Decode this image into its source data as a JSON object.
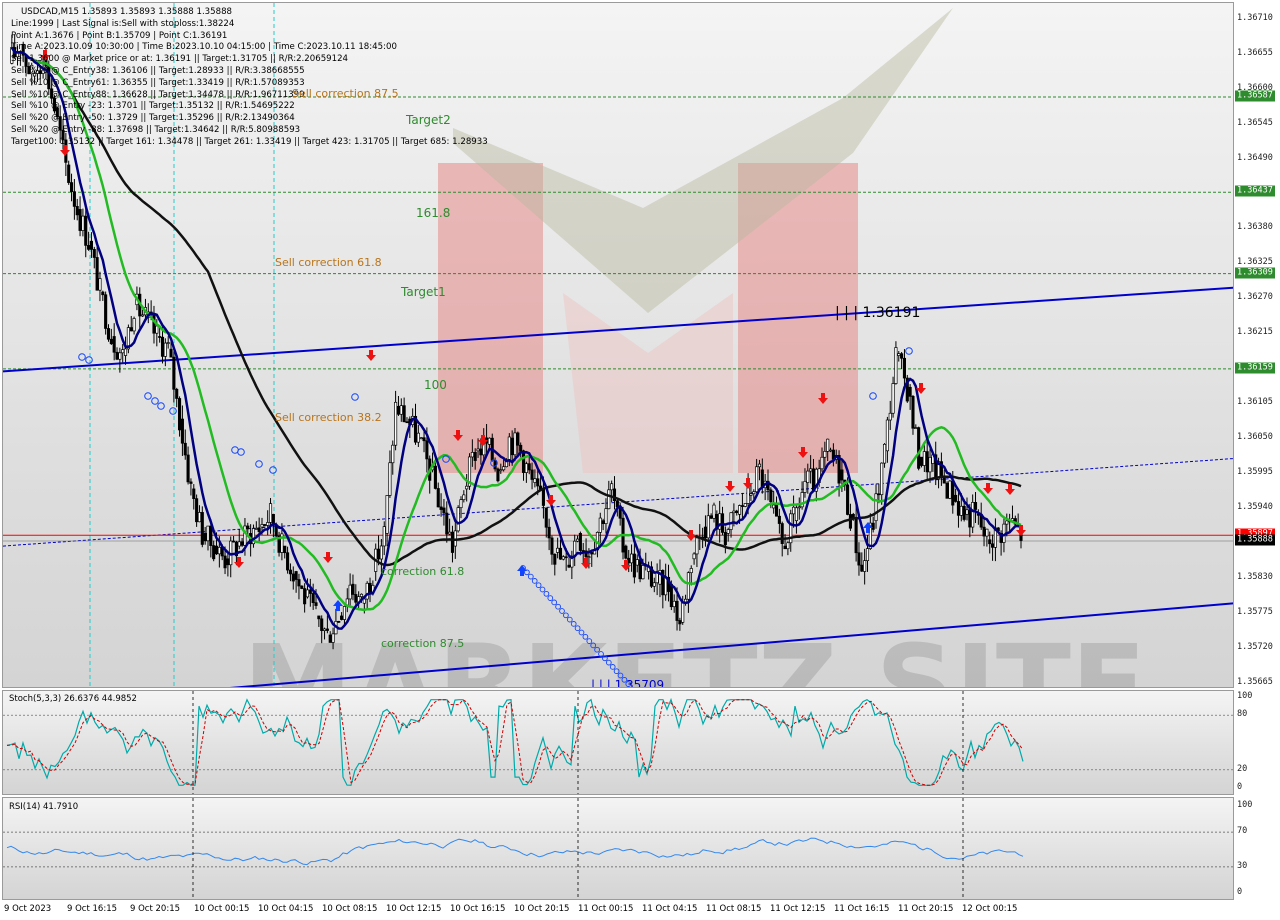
{
  "header": {
    "symbol": "USDCAD,M15  1.35893 1.35893 1.35888 1.35888",
    "lines": [
      "Line:1999 | Last Signal is:Sell with stoploss:1.38224",
      "Point A:1.3676 | Point B:1.35709 | Point C:1.36191",
      "Time A:2023.10.09 10:30:00 | Time B:2023.10.10 04:15:00 | Time C:2023.10.11 18:45:00",
      "Sell 1.3600 @ Market price or at: 1.36191 || Target:1.31705 || R/R:2.20659124",
      "Sell %10 @ C_Entry38: 1.36106 || Target:1.28933 || R/R:3.38668555",
      "Sell %10 @ C_Entry61: 1.36355 || Target:1.33419 || R/R:1.57089353",
      "Sell %10 @ C_Entry88: 1.36628 || Target:1.34478 || R/R:1.96711399",
      "Sell %10 @ Entry -23: 1.3701 || Target:1.35132 || R/R:1.54695222",
      "Sell %20 @ Entry -50: 1.3729 || Target:1.35296 || R/R:2.13490364",
      "Sell %20 @ Entry -88: 1.37698 || Target:1.34642 || R/R:5.80988593",
      "Target100: 1.35132 || Target 161: 1.34478 || Target 261: 1.33419 || Target 423: 1.31705 || Target 685: 1.28933"
    ]
  },
  "colors": {
    "up_candle": "#000000",
    "down_candle": "#000000",
    "ma_fast": "#000080",
    "ma_mid": "#22bb22",
    "ma_slow": "#111111",
    "channel": "#0000cc",
    "level_line": "#2e8b2e",
    "current_price_line": "#ff0000",
    "signal_arrow": "#ee1111",
    "stoch_main": "#00aaaa",
    "stoch_signal": "#cc0000",
    "rsi": "#3388ee"
  },
  "price_axis": {
    "labels": [
      "1.36710",
      "1.36655",
      "1.36600",
      "1.36545",
      "1.36490",
      "1.36435",
      "1.36380",
      "1.36325",
      "1.36270",
      "1.36215",
      "1.36160",
      "1.36105",
      "1.36050",
      "1.35995",
      "1.35940",
      "1.35885",
      "1.35830",
      "1.35775",
      "1.35720",
      "1.35665"
    ],
    "tags": [
      {
        "value": "1.36587",
        "color": "#2e8b2e"
      },
      {
        "value": "1.36437",
        "color": "#2e8b2e"
      },
      {
        "value": "1.36309",
        "color": "#2e8b2e"
      },
      {
        "value": "1.36159",
        "color": "#2e8b2e"
      },
      {
        "value": "1.35897",
        "color": "#ff0000"
      },
      {
        "value": "1.35888",
        "color": "#000000"
      }
    ]
  },
  "annotations": {
    "target2": "Target2",
    "level_1618": "161.8",
    "target1": "Target1",
    "level_100": "100",
    "sell_corr_875": "Sell correction 87.5",
    "sell_corr_618": "Sell correction 61.8",
    "sell_corr_382": "Sell correction 38.2",
    "corr_618": "correction 61.8",
    "corr_875": "correction 87.5",
    "point_c": "| | | 1.36191",
    "point_b": "| | | 1.35709"
  },
  "stoch": {
    "title": "Stoch(5,3,3) 26.6376 44.9852",
    "levels": [
      "100",
      "80",
      "20",
      "0"
    ]
  },
  "rsi": {
    "title": "RSI(14) 41.7910",
    "levels": [
      "100",
      "70",
      "30",
      "0"
    ]
  },
  "time_axis": [
    "9 Oct 2023",
    "9 Oct 16:15",
    "9 Oct 20:15",
    "10 Oct 00:15",
    "10 Oct 04:15",
    "10 Oct 08:15",
    "10 Oct 12:15",
    "10 Oct 16:15",
    "10 Oct 20:15",
    "11 Oct 00:15",
    "11 Oct 04:15",
    "11 Oct 08:15",
    "11 Oct 12:15",
    "11 Oct 16:15",
    "11 Oct 20:15",
    "12 Oct 00:15"
  ],
  "chart_data": {
    "type": "candlestick",
    "symbol": "USDCAD",
    "timeframe": "M15",
    "ylim": [
      1.35655,
      1.36735
    ],
    "close_series": [
      1.3664,
      1.3667,
      1.3662,
      1.3665,
      1.3657,
      1.3648,
      1.3641,
      1.3636,
      1.3628,
      1.3621,
      1.3618,
      1.3626,
      1.3624,
      1.3621,
      1.3619,
      1.3608,
      1.3597,
      1.359,
      1.3588,
      1.3586,
      1.3588,
      1.359,
      1.3591,
      1.3593,
      1.3588,
      1.3584,
      1.358,
      1.3577,
      1.3574,
      1.3577,
      1.3582,
      1.3579,
      1.3584,
      1.359,
      1.361,
      1.3608,
      1.3605,
      1.36,
      1.3594,
      1.3588,
      1.3597,
      1.3603,
      1.3604,
      1.36,
      1.3605,
      1.3603,
      1.3598,
      1.3594,
      1.3587,
      1.3585,
      1.359,
      1.3587,
      1.3592,
      1.3597,
      1.3588,
      1.3585,
      1.3584,
      1.3582,
      1.3582,
      1.3576,
      1.3586,
      1.3591,
      1.3593,
      1.359,
      1.3593,
      1.3596,
      1.36,
      1.3594,
      1.3588,
      1.3592,
      1.3598,
      1.3598,
      1.3603,
      1.36,
      1.3593,
      1.3584,
      1.3592,
      1.3603,
      1.3618,
      1.3613,
      1.3602,
      1.3601,
      1.3599,
      1.3596,
      1.3593,
      1.3593,
      1.3589,
      1.359,
      1.3592,
      1.359
    ]
  }
}
